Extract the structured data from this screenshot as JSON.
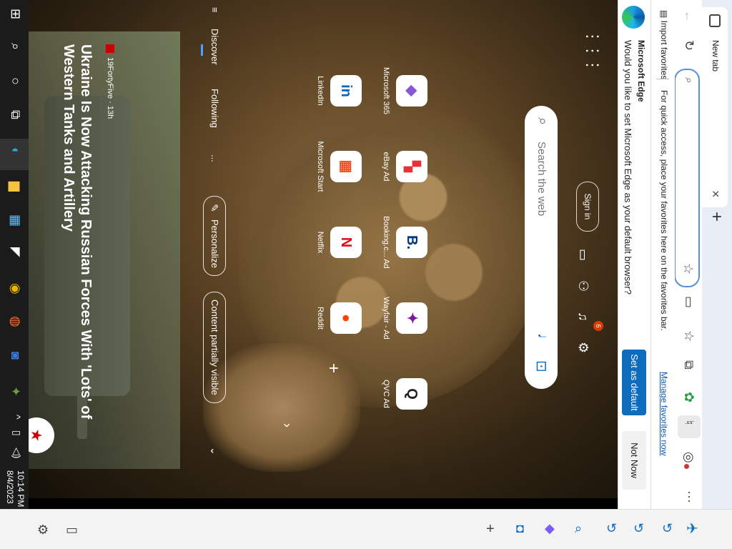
{
  "browser": {
    "tab_title": "New tab",
    "favorites_import": "Import favorites",
    "favorites_hint": "For quick access, place your favorites here on the favorites bar.",
    "favorites_manage": "Manage favorites now",
    "default_prompt": {
      "title": "Microsoft Edge",
      "text": "Would you like to set Microsoft Edge as your default browser?",
      "set_default": "Set as default",
      "not_now": "Not Now"
    }
  },
  "newtab": {
    "search_placeholder": "Search the web",
    "sign_in": "Sign in",
    "notification_count": "6",
    "tiles": [
      {
        "label": "Microsoft 365",
        "glyph": "◆",
        "color": "#8a58d6"
      },
      {
        "label": "eBay Ad",
        "glyph": "▚",
        "color": "#e53238"
      },
      {
        "label": "Booking.c... Ad",
        "glyph": "B.",
        "color": "#003580"
      },
      {
        "label": "Wayfair - Ad",
        "glyph": "✦",
        "color": "#7b189f"
      },
      {
        "label": "QVC Ad",
        "glyph": "Q",
        "color": "#222222"
      },
      {
        "label": "LinkedIn",
        "glyph": "in",
        "color": "#0a66c2"
      },
      {
        "label": "Microsoft Start",
        "glyph": "▦",
        "color": "#f25022"
      },
      {
        "label": "Netflix",
        "glyph": "N",
        "color": "#e50914"
      },
      {
        "label": "Reddit",
        "glyph": "●",
        "color": "#ff4500"
      }
    ],
    "feed": {
      "tab_discover": "Discover",
      "tab_following": "Following",
      "more": "...",
      "personalize": "Personalize",
      "content_visibility": "Content partially visible"
    },
    "news": {
      "source": "19FortyFive · 13h",
      "source_short": "19FortyFive",
      "title": "Ukraine Is Now Attacking Russian Forces With 'Lots' of Western Tanks and Artillery"
    }
  },
  "taskbar": {
    "time": "10:14 PM",
    "date": "8/4/2023"
  }
}
